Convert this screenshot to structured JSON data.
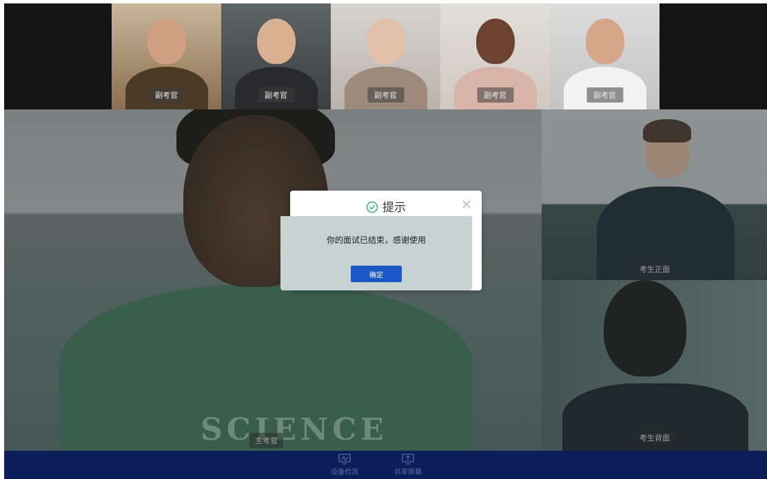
{
  "deputy_examiners": [
    {
      "label": "副考官"
    },
    {
      "label": "副考官"
    },
    {
      "label": "副考官"
    },
    {
      "label": "副考官"
    },
    {
      "label": "副考官"
    }
  ],
  "main_video": {
    "label": "主考官",
    "shirt_text": "SCIENCE"
  },
  "candidates": [
    {
      "label": "考生正面"
    },
    {
      "label": "考生背面"
    }
  ],
  "toolbar": {
    "device_check_label": "设备检测",
    "share_screen_label": "共享屏幕"
  },
  "dialog": {
    "title": "提示",
    "message": "你的面试已结束，感谢使用",
    "confirm_label": "确定"
  },
  "colors": {
    "toolbar_bg": "#0b1d5a",
    "confirm_button": "#1a57c7",
    "success_icon": "#2eb67d"
  }
}
